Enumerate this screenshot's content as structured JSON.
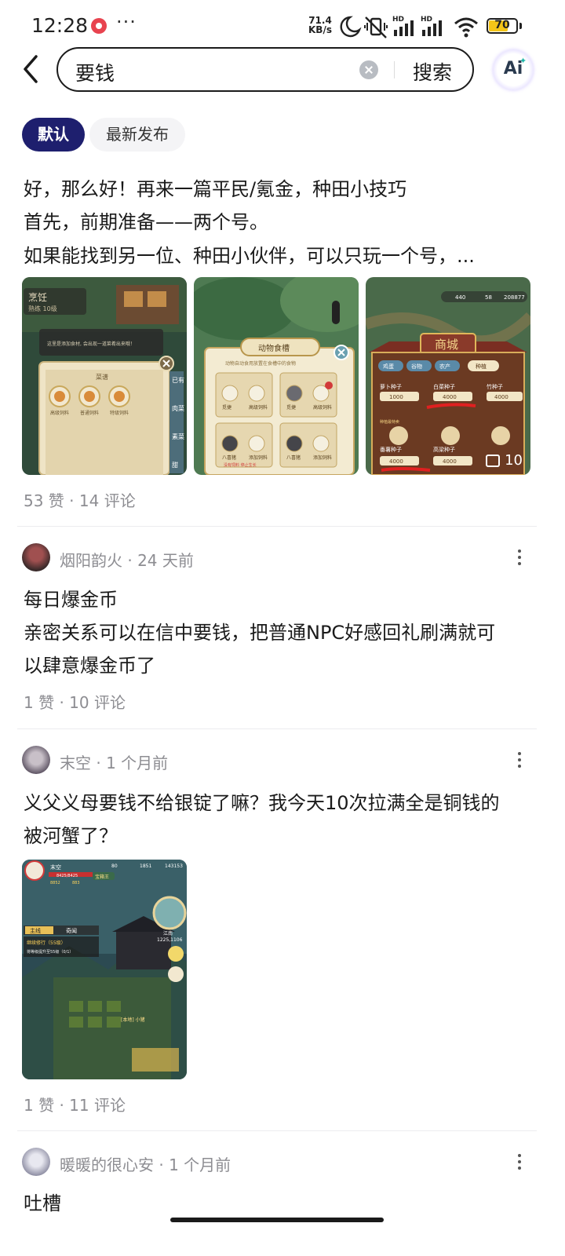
{
  "status_bar": {
    "time": "12:28",
    "dots": "···",
    "net_speed_value": "71.4",
    "net_speed_unit": "KB/s",
    "hd1": "HD",
    "hd2": "HD",
    "battery": "70",
    "battery_level": 0.7
  },
  "search": {
    "query": "要钱",
    "submit_label": "搜索",
    "ai_label": "Ai"
  },
  "tabs": [
    {
      "label": "默认",
      "active": true
    },
    {
      "label": "最新发布",
      "active": false
    }
  ],
  "posts": [
    {
      "lines": [
        "好，那么好！再来一篇平民/氪金，种田小技巧",
        "首先，前期准备——两个号。",
        "如果能找到另一位、种田小伙伴，可以只玩一个号，..."
      ],
      "image_count": "10",
      "thumb1": {
        "title": "烹饪",
        "sub": "熟练 10级",
        "note": "这里是添加食材, 会出现一道菜肴出来哦！",
        "panel_title": "菜谱",
        "items": [
          "高级饲料",
          "普通饲料",
          "特级饲料"
        ],
        "side_tabs": [
          "已有",
          "肉菜",
          "素菜",
          "甜"
        ]
      },
      "thumb2": {
        "title": "动物食槽",
        "note": "动物自动食用放置在食槽中的食物",
        "slots": [
          "觅捷",
          "高级饲料",
          "觅捷",
          "高级饲料",
          "八喜猪",
          "添加饲料",
          "八喜猪",
          "添加饲料"
        ],
        "status": "没有饲料 停止生长"
      },
      "thumb3": {
        "title": "商城",
        "top_values": [
          "440",
          "58",
          "208877"
        ],
        "tabs": [
          "鸡蛋",
          "谷物",
          "农产",
          "种植"
        ],
        "items": [
          "萝卜种子",
          "白菜种子",
          "竹种子",
          "番薯种子",
          "高梁种子",
          ""
        ],
        "prices": [
          "1000",
          "4000",
          "4000",
          "4000",
          "4000",
          ""
        ],
        "tag": "种植最特卖"
      },
      "likes": "53 赞",
      "comments": "14 评论"
    },
    {
      "author": "烟阳韵火",
      "time": "24 天前",
      "title": "每日爆金币",
      "lines": [
        "亲密关系可以在信中要钱，把普通NPC好感回礼刷满就可",
        "以肆意爆金币了"
      ],
      "likes": "1 赞",
      "comments": "10 评论"
    },
    {
      "author": "末空",
      "time": "1 个月前",
      "lines": [
        "义父义母要钱不给银锭了嘛？我今天10次拉满全是铜钱的",
        "被河蟹了？"
      ],
      "thumb": {
        "player_name": "末空",
        "hp": "8425/8425",
        "stats": [
          "80",
          "1851",
          "143153"
        ],
        "small_values": [
          "8852",
          "883"
        ],
        "tabs": [
          "主线",
          "奇闻"
        ],
        "quest_title": "继续修行（55级）",
        "quest_desc": "将等级提升至55级（0/1）",
        "location": "江南",
        "coords": "1225,1106",
        "label_chip": "宝箱王",
        "ground_text": "[本地] 小猪"
      },
      "likes": "1 赞",
      "comments": "11 评论"
    },
    {
      "author": "暖暖的很心安",
      "time": "1 个月前",
      "title": "吐槽"
    }
  ]
}
